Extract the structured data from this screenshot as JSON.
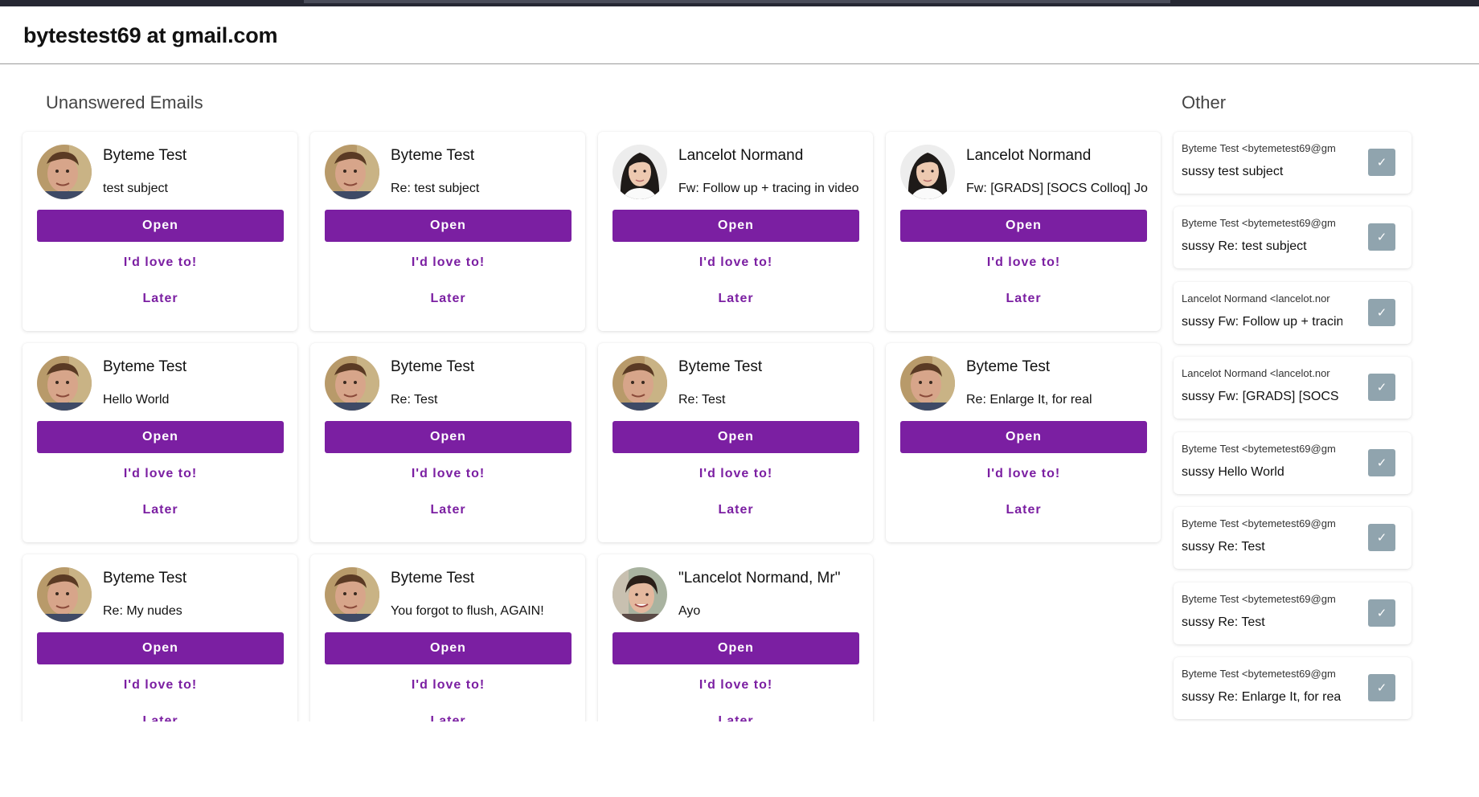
{
  "header": {
    "title": "bytestest69 at gmail.com"
  },
  "sections": {
    "unanswered": "Unanswered Emails",
    "other": "Other"
  },
  "buttons": {
    "open": "Open",
    "love": "I'd love to!",
    "later": "Later",
    "check": "✓"
  },
  "cards": [
    {
      "sender": "Byteme Test",
      "subject": "test subject",
      "avatar": "man-avatar"
    },
    {
      "sender": "Byteme Test",
      "subject": "Re: test subject",
      "avatar": "man-avatar"
    },
    {
      "sender": "Lancelot Normand",
      "subject": "Fw: Follow up + tracing in video",
      "avatar": "woman-avatar"
    },
    {
      "sender": "Lancelot Normand",
      "subject": "Fw: [GRADS] [SOCS Colloq] Jo",
      "avatar": "woman-avatar"
    },
    {
      "sender": "Byteme Test",
      "subject": "Hello World",
      "avatar": "man-avatar"
    },
    {
      "sender": "Byteme Test",
      "subject": "Re: Test",
      "avatar": "man-avatar"
    },
    {
      "sender": "Byteme Test",
      "subject": "Re: Test",
      "avatar": "man-avatar"
    },
    {
      "sender": "Byteme Test",
      "subject": "Re: Enlarge It, for real",
      "avatar": "man-avatar"
    },
    {
      "sender": "Byteme Test",
      "subject": "Re: My nudes",
      "avatar": "man-avatar"
    },
    {
      "sender": "Byteme Test",
      "subject": "You forgot to flush, AGAIN!",
      "avatar": "man-avatar"
    },
    {
      "sender": "\"Lancelot Normand, Mr\"",
      "subject": "Ayo",
      "avatar": "person-avatar"
    }
  ],
  "other": [
    {
      "from": "Byteme Test <bytemetest69@gm",
      "subject": "sussy test subject"
    },
    {
      "from": "Byteme Test <bytemetest69@gm",
      "subject": "sussy Re: test subject"
    },
    {
      "from": "Lancelot Normand <lancelot.nor",
      "subject": "sussy Fw: Follow up + tracin"
    },
    {
      "from": "Lancelot Normand <lancelot.nor",
      "subject": "sussy Fw: [GRADS] [SOCS"
    },
    {
      "from": "Byteme Test <bytemetest69@gm",
      "subject": "sussy Hello World"
    },
    {
      "from": "Byteme Test <bytemetest69@gm",
      "subject": "sussy Re: Test"
    },
    {
      "from": "Byteme Test <bytemetest69@gm",
      "subject": "sussy Re: Test"
    },
    {
      "from": "Byteme Test <bytemetest69@gm",
      "subject": "sussy Re: Enlarge It, for rea"
    }
  ],
  "colors": {
    "primary": "#7b1fa2",
    "check": "#90a4ae"
  }
}
